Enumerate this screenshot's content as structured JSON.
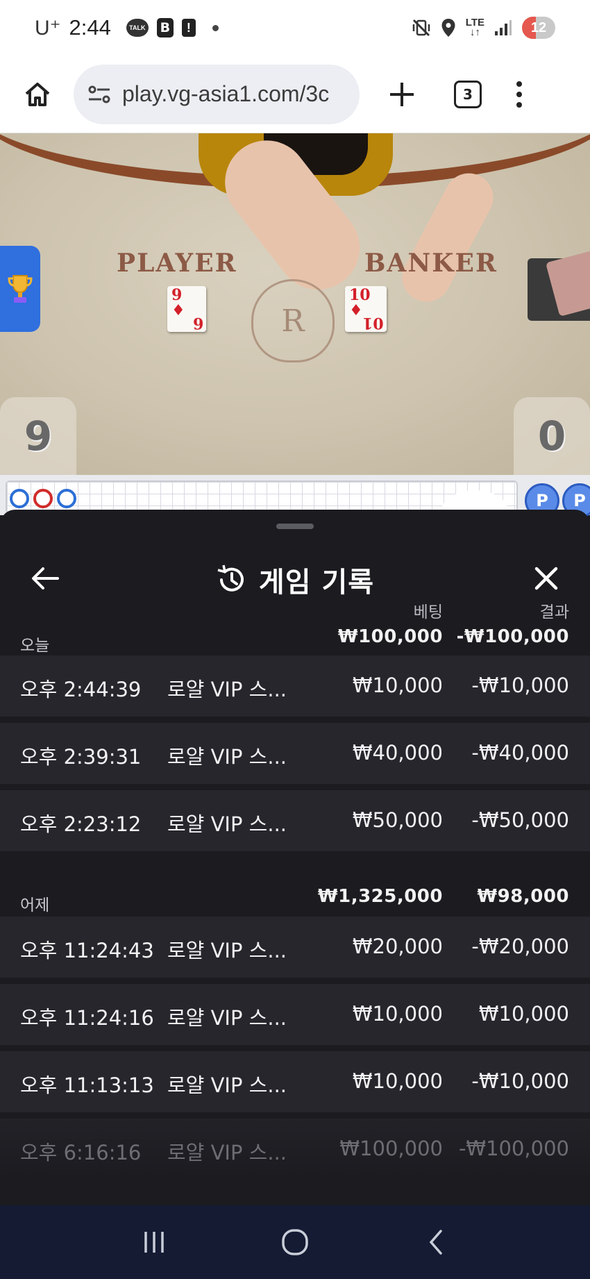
{
  "status_bar": {
    "carrier": "U⁺",
    "time": "2:44",
    "talk_badge": "TALK",
    "b_badge": "B",
    "alert_badge": "!",
    "network": "LTE",
    "battery_level": "12",
    "battery_fraction": 0.12,
    "icons": [
      "kakaotalk-icon",
      "blog-icon",
      "alert-icon",
      "dot-icon",
      "vibrate-mute-icon",
      "location-icon",
      "signal-icon",
      "battery-icon"
    ]
  },
  "browser": {
    "url": "play.vg-asia1.com/3c",
    "tab_count": "3"
  },
  "game": {
    "player_label": "PLAYER",
    "banker_label": "BANKER",
    "player_card": {
      "rank": "9",
      "suit": "♦",
      "bottom": "6"
    },
    "banker_card": {
      "rank": "10",
      "suit": "♦",
      "bottom": "01"
    },
    "crest_letter": "R",
    "player_score": "9",
    "banker_score": "0",
    "side_badge": "P",
    "colors": {
      "player_blue": "#2c6fd6",
      "banker_red": "#d12b2b"
    }
  },
  "history": {
    "title": "게임 기록",
    "col_bet": "베팅",
    "col_result": "결과",
    "sections": [
      {
        "label": "오늘",
        "total_bet": "₩100,000",
        "total_result": "-₩100,000",
        "rows": [
          {
            "time": "오후 2:44:39",
            "game": "로얄 VIP 스...",
            "bet": "₩10,000",
            "result": "-₩10,000"
          },
          {
            "time": "오후 2:39:31",
            "game": "로얄 VIP 스...",
            "bet": "₩40,000",
            "result": "-₩40,000"
          },
          {
            "time": "오후 2:23:12",
            "game": "로얄 VIP 스...",
            "bet": "₩50,000",
            "result": "-₩50,000"
          }
        ]
      },
      {
        "label": "어제",
        "total_bet": "₩1,325,000",
        "total_result": "₩98,000",
        "rows": [
          {
            "time": "오후 11:24:43",
            "game": "로얄 VIP 스...",
            "bet": "₩20,000",
            "result": "-₩20,000"
          },
          {
            "time": "오후 11:24:16",
            "game": "로얄 VIP 스...",
            "bet": "₩10,000",
            "result": "₩10,000"
          },
          {
            "time": "오후 11:13:13",
            "game": "로얄 VIP 스...",
            "bet": "₩10,000",
            "result": "-₩10,000"
          },
          {
            "time": "오후 6:16:16",
            "game": "로얄 VIP 스...",
            "bet": "₩100,000",
            "result": "-₩100,000"
          }
        ]
      }
    ]
  }
}
